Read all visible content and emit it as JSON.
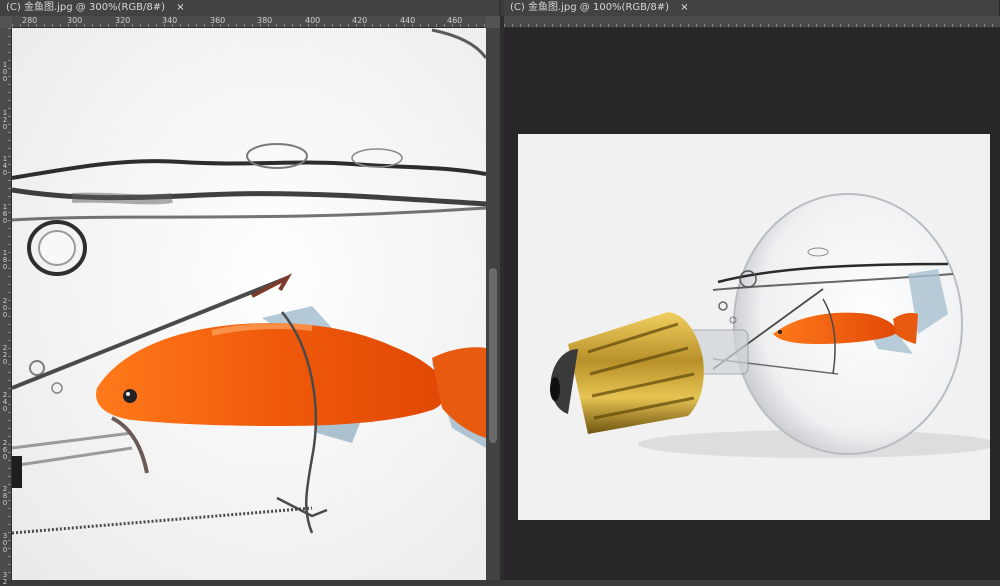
{
  "tabs": [
    {
      "label": "(C) 金鱼图.jpg @ 300%(RGB/8#)",
      "close": "×"
    },
    {
      "label": "(C) 金鱼图.jpg @ 100%(RGB/8#)",
      "close": "×"
    }
  ],
  "left_ruler": {
    "top_ticks": [
      "280",
      "300",
      "320",
      "340",
      "360",
      "380",
      "400",
      "420",
      "440",
      "460"
    ],
    "left_ticks": [
      "1 0 0",
      "1 2 0",
      "1 4 0",
      "1 6 0",
      "1 8 0",
      "2 0 0",
      "2 2 0",
      "2 4 0",
      "2 6 0",
      "2 8 0",
      "3 0 0",
      "3 2"
    ]
  },
  "colors": {
    "app_background": "#3a3a3a",
    "canvas_backdrop": "#282629",
    "fish_orange": "#f05a0a",
    "bulb_brass": "#b8902a"
  },
  "icons": {
    "tab_close": "close-icon"
  }
}
